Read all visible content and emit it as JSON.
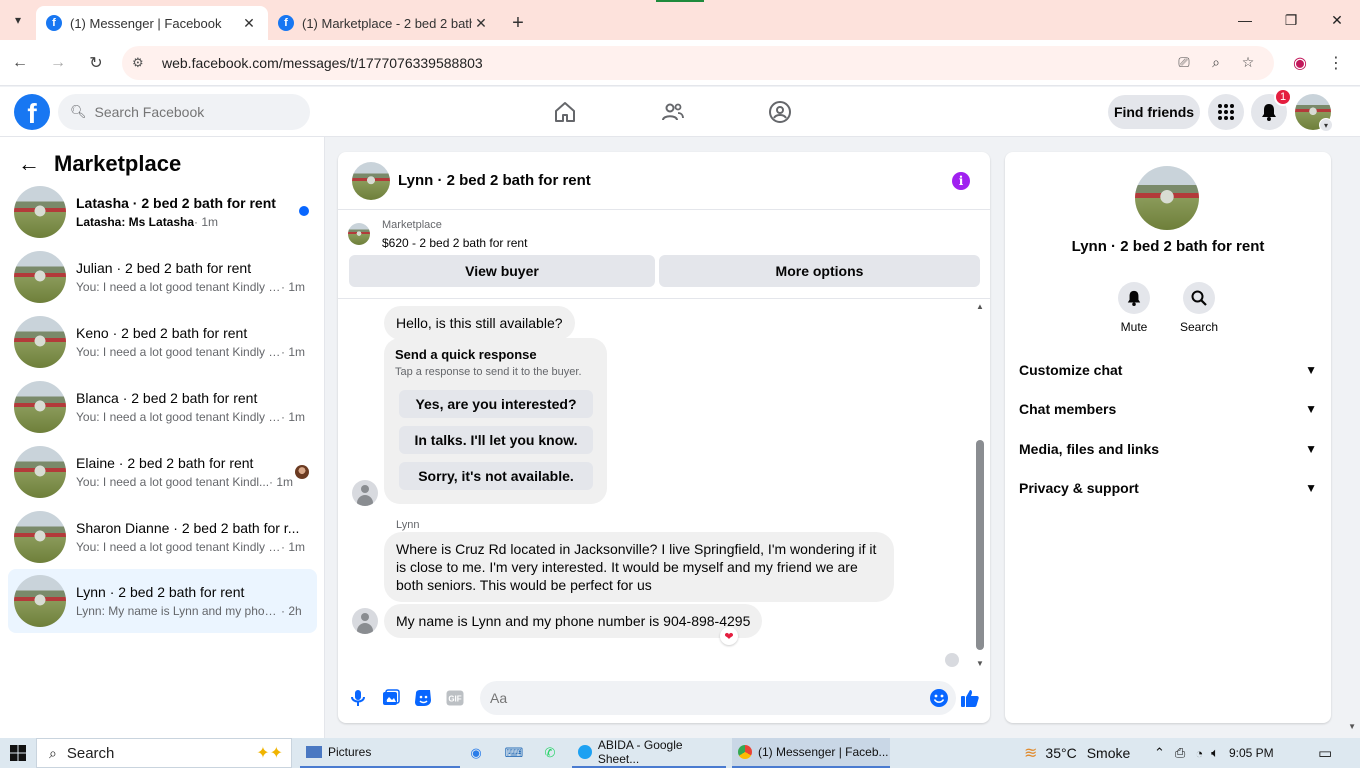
{
  "browser": {
    "tabs": [
      {
        "title": "(1) Messenger | Facebook",
        "active": true
      },
      {
        "title": "(1) Marketplace - 2 bed 2 bath f",
        "active": false
      }
    ],
    "url": "web.facebook.com/messages/t/1777076339588803"
  },
  "fb": {
    "search_placeholder": "Search Facebook",
    "find_friends": "Find friends",
    "notification_count": "1"
  },
  "sidebar": {
    "title": "Marketplace",
    "conversations": [
      {
        "name": "Latasha · 2 bed 2 bath for rent",
        "snippet": "Latasha: Ms Latasha",
        "time": " · 1m",
        "unread": true
      },
      {
        "name": "Julian · 2 bed 2 bath for rent",
        "snippet": "You: I need a lot good tenant Kindly s...",
        "time": " · 1m"
      },
      {
        "name": "Keno · 2 bed 2 bath for rent",
        "snippet": "You: I need a lot good tenant Kindly s...",
        "time": " · 1m"
      },
      {
        "name": "Blanca · 2 bed 2 bath for rent",
        "snippet": "You: I need a lot good tenant Kindly s...",
        "time": " · 1m"
      },
      {
        "name": "Elaine · 2 bed 2 bath for rent",
        "snippet": "You: I need a lot good tenant Kindl...",
        "time": " · 1m"
      },
      {
        "name": "Sharon Dianne · 2 bed 2 bath for r...",
        "snippet": "You: I need a lot good tenant Kindly s...",
        "time": " · 1m"
      },
      {
        "name": "Lynn · 2 bed 2 bath for rent",
        "snippet": "Lynn: My name is Lynn and my phone...",
        "time": " · 2h",
        "selected": true
      }
    ]
  },
  "chat": {
    "title": "Lynn · 2 bed 2 bath for rent",
    "marketplace_label": "Marketplace",
    "listing": "$620 - 2 bed 2 bath for rent",
    "view_buyer": "View buyer",
    "more_options": "More options",
    "msg1": "Hello, is this still available?",
    "quick_title": "Send a quick response",
    "quick_sub": "Tap a response to send it to the buyer.",
    "quick_options": [
      "Yes, are you interested?",
      "In talks. I'll let you know.",
      "Sorry, it's not available."
    ],
    "sender": "Lynn",
    "msg2": "Where is Cruz Rd located in Jacksonville? I live Springfield, I'm wondering if it is close to me. I'm very interested. It would be myself and my friend we are both seniors. This would be perfect for us",
    "msg3": "My name is Lynn and my phone number is 904-898-4295",
    "reaction": "❤",
    "composer_placeholder": "Aa"
  },
  "details": {
    "name": "Lynn · 2 bed 2 bath for rent",
    "mute": "Mute",
    "search": "Search",
    "sections": [
      "Customize chat",
      "Chat members",
      "Media, files and links",
      "Privacy & support"
    ]
  },
  "taskbar": {
    "search": "Search",
    "pictures": "Pictures",
    "sheets": "ABIDA - Google Sheet...",
    "messenger": "(1) Messenger | Faceb...",
    "temp": "35°C",
    "weather": "Smoke",
    "time": "9:05 PM"
  },
  "colors": {
    "accent": "#0866ff",
    "fb_blue": "#1877f2",
    "info_purple": "#a020f0",
    "tab_strip": "#fde2dc"
  }
}
